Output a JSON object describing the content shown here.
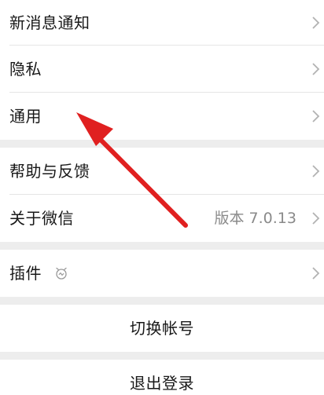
{
  "settings": {
    "items": [
      {
        "label": "新消息通知"
      },
      {
        "label": "隐私"
      },
      {
        "label": "通用"
      },
      {
        "label": "帮助与反馈"
      },
      {
        "label": "关于微信",
        "value": "版本 7.0.13"
      },
      {
        "label": "插件"
      }
    ],
    "switch_account_label": "切换帐号",
    "logout_label": "退出登录"
  },
  "icons": {
    "chevron": "chevron-right-icon",
    "plugin": "plugin-icon"
  },
  "colors": {
    "background": "#EDEDED",
    "row": "#FFFFFF",
    "text": "#181818",
    "secondary_text": "#8A8A8A",
    "chevron": "#B2B2B2",
    "annotation_arrow": "#E02020"
  }
}
